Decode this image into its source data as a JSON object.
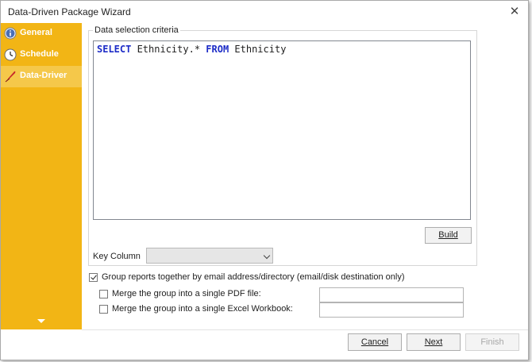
{
  "window": {
    "title": "Data-Driven Package Wizard",
    "close_glyph": "✕"
  },
  "sidebar": {
    "items": [
      {
        "label": "General",
        "icon": "info-icon",
        "active": false
      },
      {
        "label": "Schedule",
        "icon": "clock-icon",
        "active": false
      },
      {
        "label": "Data-Driver",
        "icon": "quill-icon",
        "active": true
      }
    ]
  },
  "criteria": {
    "legend": "Data selection criteria",
    "query": {
      "kw1": "SELECT",
      "mid": " Ethnicity.* ",
      "kw2": "FROM",
      "tail": " Ethnicity"
    },
    "build_label": "Build",
    "key_column_label": "Key Column",
    "key_column_value": ""
  },
  "options": {
    "group_reports_label": "Group reports together by email address/directory (email/disk destination only)",
    "group_reports_checked": true,
    "merge_pdf_label": "Merge the group into a single PDF file:",
    "merge_pdf_checked": false,
    "merge_pdf_value": "",
    "merge_excel_label": "Merge the group into a single Excel Workbook:",
    "merge_excel_checked": false,
    "merge_excel_value": ""
  },
  "footer": {
    "cancel_label": "Cancel",
    "next_label": "Next",
    "finish_label": "Finish"
  },
  "colors": {
    "sidebar": "#f2b515",
    "keyword": "#1d2cc7"
  }
}
